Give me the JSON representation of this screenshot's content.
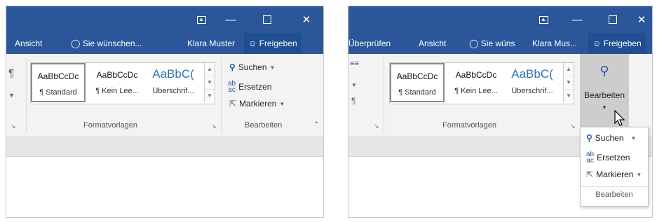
{
  "left_window": {
    "tabs": {
      "ansicht": "Ansicht",
      "tell_me": "Sie wünschen...",
      "user": "Klara Muster",
      "share": "Freigeben"
    },
    "ribbon": {
      "paragraph_mark": "¶",
      "styles": [
        {
          "preview": "AaBbCcDc",
          "name": "¶ Standard"
        },
        {
          "preview": "AaBbCcDc",
          "name": "¶ Kein Lee..."
        },
        {
          "preview": "AaBbC(",
          "name": "Überschrif..."
        }
      ],
      "formatvorlagen_label": "Formatvorlagen",
      "bearbeiten_label": "Bearbeiten",
      "commands": {
        "suchen": "Suchen",
        "ersetzen": "Ersetzen",
        "markieren": "Markieren"
      }
    }
  },
  "right_window": {
    "tabs": {
      "ueberpruefen": "Überprüfen",
      "ansicht": "Ansicht",
      "tell_me": "Sie wüns",
      "user": "Klara Mus...",
      "share": "Freigeben"
    },
    "ribbon": {
      "styles": [
        {
          "preview": "AaBbCcDc",
          "name": "¶ Standard"
        },
        {
          "preview": "AaBbCcDc",
          "name": "¶ Kein Lee..."
        },
        {
          "preview": "AaBbC(",
          "name": "Überschrif..."
        }
      ],
      "formatvorlagen_label": "Formatvorlagen",
      "bearbeiten_button": "Bearbeiten"
    },
    "dropdown": {
      "suchen": "Suchen",
      "ersetzen": "Ersetzen",
      "markieren": "Markieren",
      "group_label": "Bearbeiten"
    }
  },
  "colors": {
    "titlebar": "#2b579a",
    "ribbon": "#f3f3f3",
    "accent": "#2e74b5"
  },
  "icons": [
    "ribbon-display-icon",
    "minimize-icon",
    "maximize-icon",
    "close-icon",
    "lightbulb-icon",
    "share-person-icon",
    "search-icon",
    "replace-icon",
    "select-cursor-icon",
    "pointer-cursor-icon"
  ]
}
